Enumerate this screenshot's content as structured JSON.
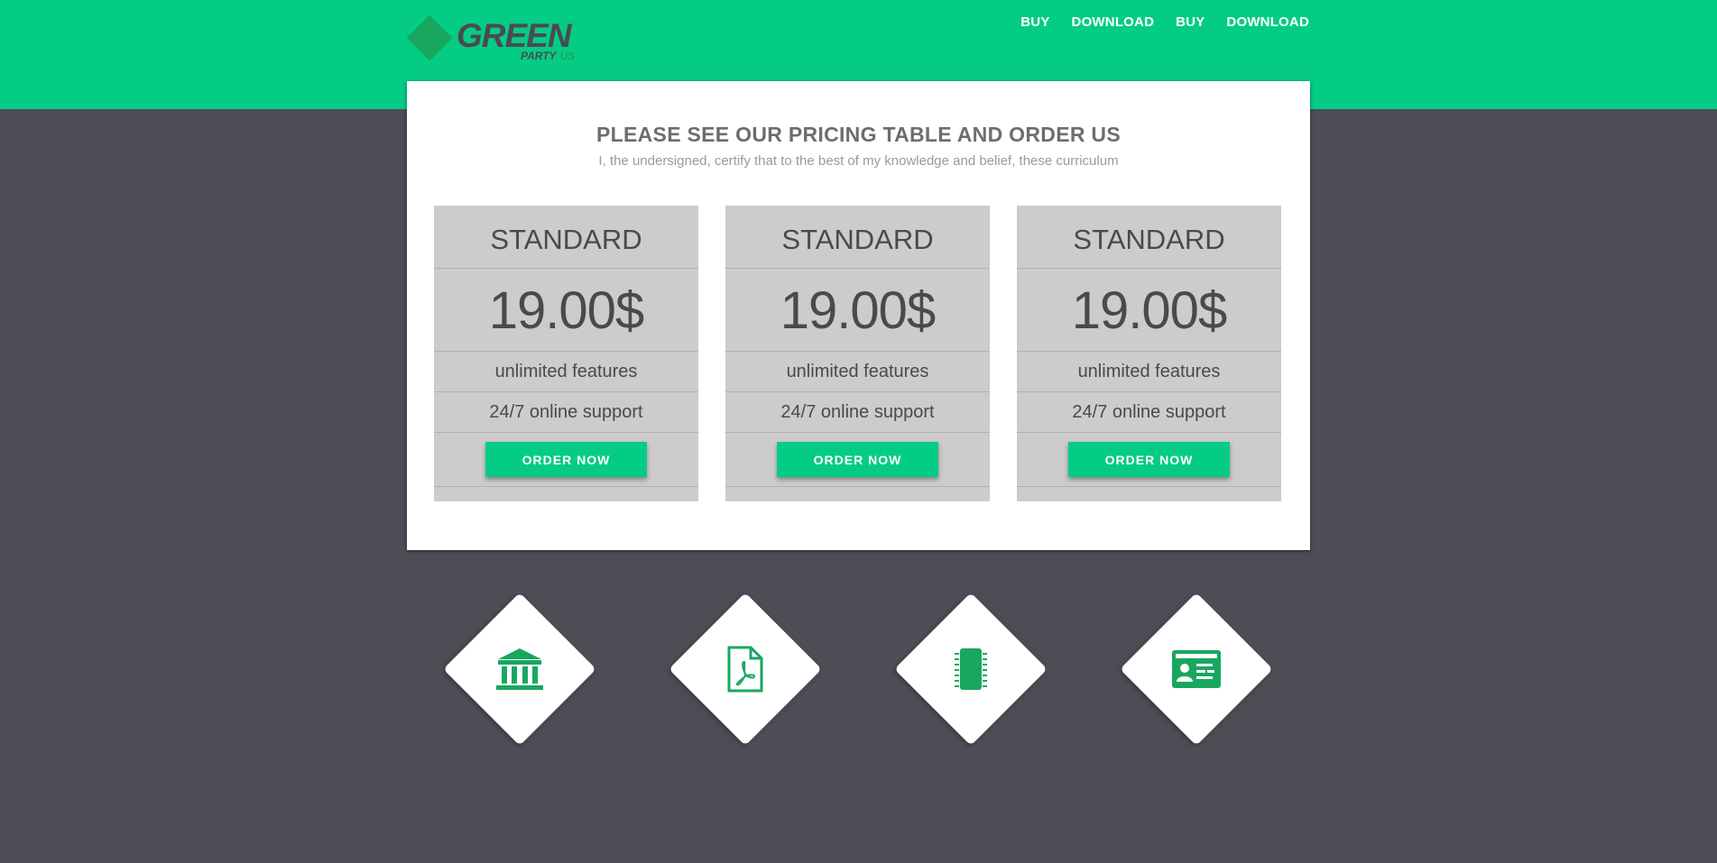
{
  "brand": {
    "name": "GREEN",
    "sub": "PARTY",
    "sub_accent": "US",
    "icon": "diamond-logo-icon"
  },
  "nav": {
    "items": [
      {
        "label": "BUY"
      },
      {
        "label": "DOWNLOAD"
      },
      {
        "label": "BUY"
      },
      {
        "label": "DOWNLOAD"
      }
    ]
  },
  "pricing": {
    "title": "PLEASE SEE OUR PRICING TABLE AND ORDER US",
    "subtitle": "I, the undersigned, certify that to the best of my knowledge and belief, these curriculum",
    "plans": [
      {
        "name": "STANDARD",
        "price": "19.00$",
        "features": [
          "unlimited features",
          "24/7 online support"
        ],
        "button": "ORDER NOW"
      },
      {
        "name": "STANDARD",
        "price": "19.00$",
        "features": [
          "unlimited features",
          "24/7 online support"
        ],
        "button": "ORDER NOW"
      },
      {
        "name": "STANDARD",
        "price": "19.00$",
        "features": [
          "unlimited features",
          "24/7 online support"
        ],
        "button": "ORDER NOW"
      }
    ]
  },
  "features": [
    {
      "icon": "bank-icon"
    },
    {
      "icon": "pdf-file-icon"
    },
    {
      "icon": "chip-icon"
    },
    {
      "icon": "id-card-icon"
    }
  ],
  "colors": {
    "accent": "#05cc84",
    "accent_dark": "#19a760",
    "background": "#4c4d55",
    "panel": "#ffffff",
    "card": "#cccccc",
    "text_dark": "#4a4a4a"
  }
}
